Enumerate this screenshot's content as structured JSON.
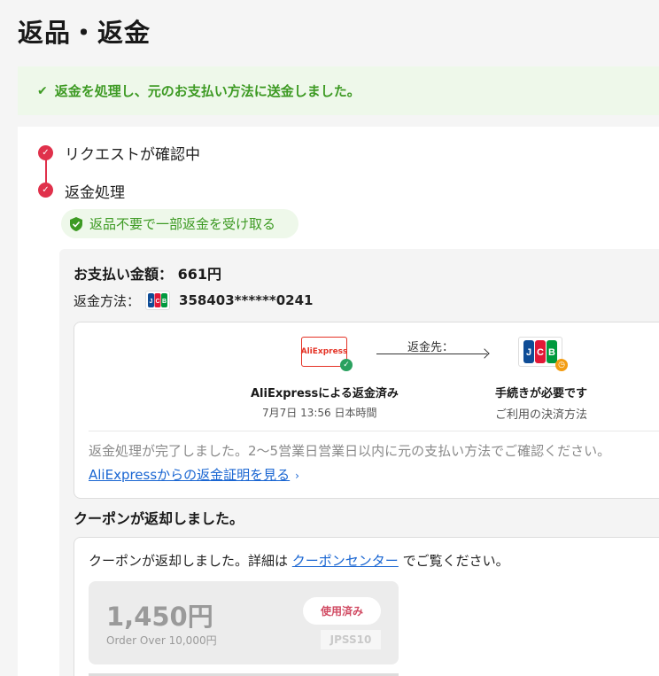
{
  "page": {
    "title": "返品・返金"
  },
  "banner": {
    "message": "返金を処理し、元のお支払い方法に送金しました。"
  },
  "steps": [
    {
      "label": "リクエストが確認中"
    },
    {
      "label": "返金処理"
    }
  ],
  "refund_tag": {
    "label": "返品不要で一部返金を受け取る"
  },
  "payment": {
    "amount_label": "お支払い金額：",
    "amount_value": "661円",
    "method_label": "返金方法：",
    "card_brand": "JCB",
    "card_number": "358403******0241"
  },
  "flow": {
    "from_logo": "AliExpress",
    "arrow_label": "返金先：",
    "to_logo": "JCB",
    "from_title": "AliExpressによる返金済み",
    "from_time": "7月7日 13:56 日本時間",
    "to_title": "手続きが必要です",
    "to_sub": "ご利用の決済方法",
    "complete_message": "返金処理が完了しました。2～5営業日営業日以内に元の支払い方法でご確認ください。",
    "proof_link": "AliExpressからの返金証明を見る",
    "proof_chevron": "›"
  },
  "coupon": {
    "heading": "クーポンが返却しました。",
    "msg_before": "クーポンが返却しました。詳細は",
    "link": "クーポンセンター",
    "msg_after": "でご覧ください。",
    "amount": "1,450円",
    "condition": "Order Over 10,000円",
    "status": "使用済み",
    "code": "JPSS10"
  },
  "icons": {
    "check": "check-icon",
    "shield": "shield-icon",
    "clock": "clock-icon"
  },
  "colors": {
    "success_green": "#3d9a23",
    "accent_red": "#e0314b",
    "link_blue": "#1a66d2"
  }
}
